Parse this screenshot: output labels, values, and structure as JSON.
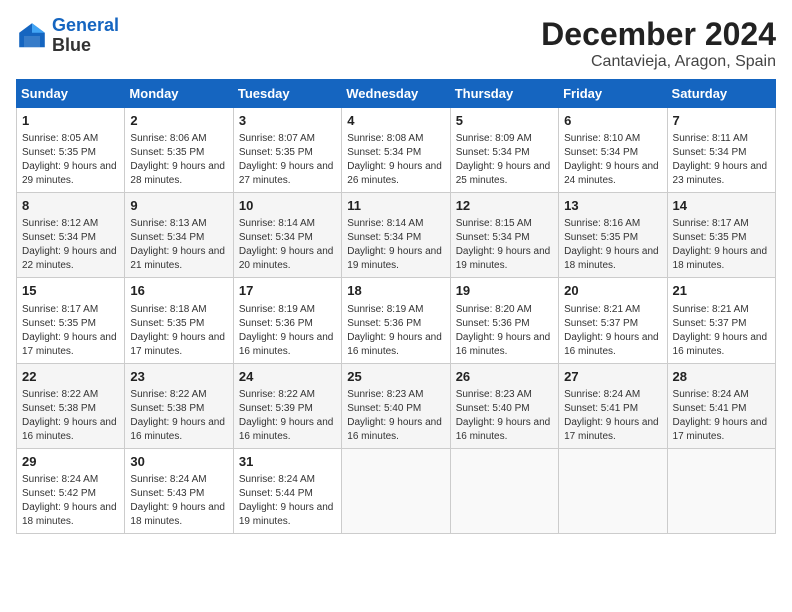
{
  "logo": {
    "line1": "General",
    "line2": "Blue"
  },
  "title": "December 2024",
  "location": "Cantavieja, Aragon, Spain",
  "weekdays": [
    "Sunday",
    "Monday",
    "Tuesday",
    "Wednesday",
    "Thursday",
    "Friday",
    "Saturday"
  ],
  "weeks": [
    [
      {
        "day": "1",
        "sunrise": "8:05 AM",
        "sunset": "5:35 PM",
        "daylight": "9 hours and 29 minutes."
      },
      {
        "day": "2",
        "sunrise": "8:06 AM",
        "sunset": "5:35 PM",
        "daylight": "9 hours and 28 minutes."
      },
      {
        "day": "3",
        "sunrise": "8:07 AM",
        "sunset": "5:35 PM",
        "daylight": "9 hours and 27 minutes."
      },
      {
        "day": "4",
        "sunrise": "8:08 AM",
        "sunset": "5:34 PM",
        "daylight": "9 hours and 26 minutes."
      },
      {
        "day": "5",
        "sunrise": "8:09 AM",
        "sunset": "5:34 PM",
        "daylight": "9 hours and 25 minutes."
      },
      {
        "day": "6",
        "sunrise": "8:10 AM",
        "sunset": "5:34 PM",
        "daylight": "9 hours and 24 minutes."
      },
      {
        "day": "7",
        "sunrise": "8:11 AM",
        "sunset": "5:34 PM",
        "daylight": "9 hours and 23 minutes."
      }
    ],
    [
      {
        "day": "8",
        "sunrise": "8:12 AM",
        "sunset": "5:34 PM",
        "daylight": "9 hours and 22 minutes."
      },
      {
        "day": "9",
        "sunrise": "8:13 AM",
        "sunset": "5:34 PM",
        "daylight": "9 hours and 21 minutes."
      },
      {
        "day": "10",
        "sunrise": "8:14 AM",
        "sunset": "5:34 PM",
        "daylight": "9 hours and 20 minutes."
      },
      {
        "day": "11",
        "sunrise": "8:14 AM",
        "sunset": "5:34 PM",
        "daylight": "9 hours and 19 minutes."
      },
      {
        "day": "12",
        "sunrise": "8:15 AM",
        "sunset": "5:34 PM",
        "daylight": "9 hours and 19 minutes."
      },
      {
        "day": "13",
        "sunrise": "8:16 AM",
        "sunset": "5:35 PM",
        "daylight": "9 hours and 18 minutes."
      },
      {
        "day": "14",
        "sunrise": "8:17 AM",
        "sunset": "5:35 PM",
        "daylight": "9 hours and 18 minutes."
      }
    ],
    [
      {
        "day": "15",
        "sunrise": "8:17 AM",
        "sunset": "5:35 PM",
        "daylight": "9 hours and 17 minutes."
      },
      {
        "day": "16",
        "sunrise": "8:18 AM",
        "sunset": "5:35 PM",
        "daylight": "9 hours and 17 minutes."
      },
      {
        "day": "17",
        "sunrise": "8:19 AM",
        "sunset": "5:36 PM",
        "daylight": "9 hours and 16 minutes."
      },
      {
        "day": "18",
        "sunrise": "8:19 AM",
        "sunset": "5:36 PM",
        "daylight": "9 hours and 16 minutes."
      },
      {
        "day": "19",
        "sunrise": "8:20 AM",
        "sunset": "5:36 PM",
        "daylight": "9 hours and 16 minutes."
      },
      {
        "day": "20",
        "sunrise": "8:21 AM",
        "sunset": "5:37 PM",
        "daylight": "9 hours and 16 minutes."
      },
      {
        "day": "21",
        "sunrise": "8:21 AM",
        "sunset": "5:37 PM",
        "daylight": "9 hours and 16 minutes."
      }
    ],
    [
      {
        "day": "22",
        "sunrise": "8:22 AM",
        "sunset": "5:38 PM",
        "daylight": "9 hours and 16 minutes."
      },
      {
        "day": "23",
        "sunrise": "8:22 AM",
        "sunset": "5:38 PM",
        "daylight": "9 hours and 16 minutes."
      },
      {
        "day": "24",
        "sunrise": "8:22 AM",
        "sunset": "5:39 PM",
        "daylight": "9 hours and 16 minutes."
      },
      {
        "day": "25",
        "sunrise": "8:23 AM",
        "sunset": "5:40 PM",
        "daylight": "9 hours and 16 minutes."
      },
      {
        "day": "26",
        "sunrise": "8:23 AM",
        "sunset": "5:40 PM",
        "daylight": "9 hours and 16 minutes."
      },
      {
        "day": "27",
        "sunrise": "8:24 AM",
        "sunset": "5:41 PM",
        "daylight": "9 hours and 17 minutes."
      },
      {
        "day": "28",
        "sunrise": "8:24 AM",
        "sunset": "5:41 PM",
        "daylight": "9 hours and 17 minutes."
      }
    ],
    [
      {
        "day": "29",
        "sunrise": "8:24 AM",
        "sunset": "5:42 PM",
        "daylight": "9 hours and 18 minutes."
      },
      {
        "day": "30",
        "sunrise": "8:24 AM",
        "sunset": "5:43 PM",
        "daylight": "9 hours and 18 minutes."
      },
      {
        "day": "31",
        "sunrise": "8:24 AM",
        "sunset": "5:44 PM",
        "daylight": "9 hours and 19 minutes."
      },
      null,
      null,
      null,
      null
    ]
  ]
}
